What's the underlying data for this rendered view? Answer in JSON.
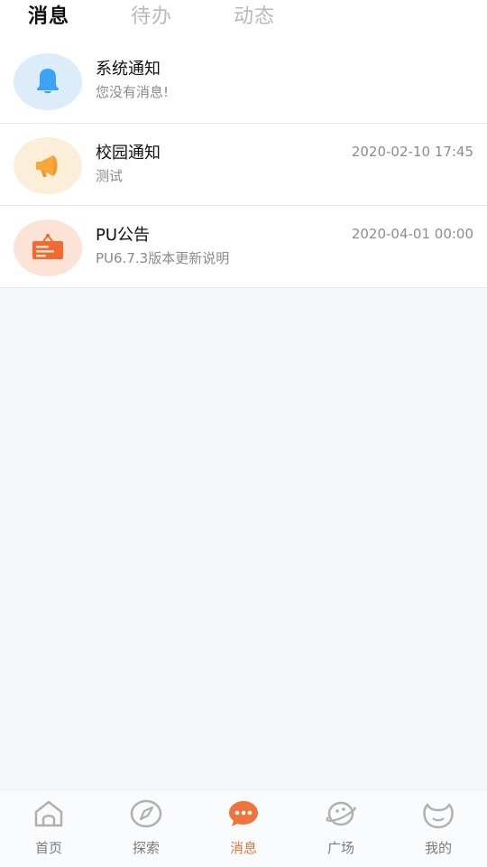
{
  "tabs": [
    {
      "label": "消息",
      "active": true
    },
    {
      "label": "待办",
      "active": false
    },
    {
      "label": "动态",
      "active": false
    }
  ],
  "messages": [
    {
      "title": "系统通知",
      "subtitle": "您没有消息!",
      "time": "",
      "icon": "bell-icon",
      "color": "#3ba2f6"
    },
    {
      "title": "校园通知",
      "subtitle": "测试",
      "time": "2020-02-10 17:45",
      "icon": "megaphone-icon",
      "color": "#f7a83a"
    },
    {
      "title": "PU公告",
      "subtitle": "PU6.7.3版本更新说明",
      "time": "2020-04-01 00:00",
      "icon": "notice-board-icon",
      "color": "#f36a2e"
    }
  ],
  "nav": [
    {
      "label": "首页",
      "icon": "home-icon",
      "active": false
    },
    {
      "label": "探索",
      "icon": "compass-icon",
      "active": false
    },
    {
      "label": "消息",
      "icon": "chat-icon",
      "active": true
    },
    {
      "label": "广场",
      "icon": "planet-icon",
      "active": false
    },
    {
      "label": "我的",
      "icon": "face-icon",
      "active": false
    }
  ],
  "colors": {
    "accent": "#f0733c",
    "background": "#f5f7f9"
  }
}
